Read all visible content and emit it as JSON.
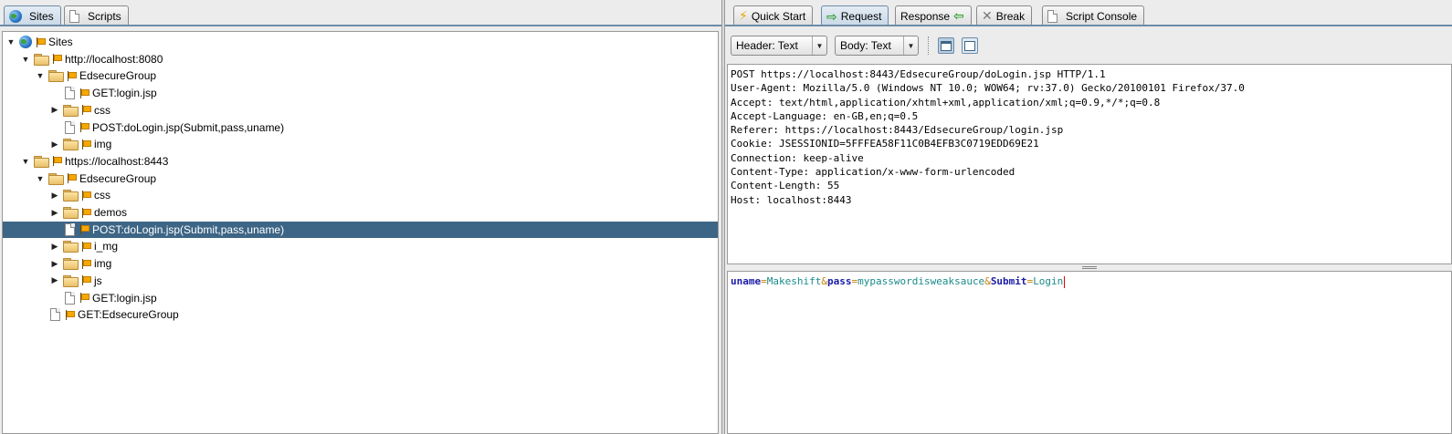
{
  "left_tabs": [
    {
      "label": "Sites",
      "icon": "globe-icon",
      "active": true
    },
    {
      "label": "Scripts",
      "icon": "script-icon",
      "active": false
    }
  ],
  "tree": [
    {
      "label": "Sites",
      "depth": 0,
      "kind": "root",
      "expanded": true
    },
    {
      "label": "http://localhost:8080",
      "depth": 1,
      "kind": "folder",
      "expanded": true
    },
    {
      "label": "EdsecureGroup",
      "depth": 2,
      "kind": "folder",
      "expanded": true
    },
    {
      "label": "GET:login.jsp",
      "depth": 3,
      "kind": "page"
    },
    {
      "label": "css",
      "depth": 3,
      "kind": "folder",
      "expanded": false
    },
    {
      "label": "POST:doLogin.jsp(Submit,pass,uname)",
      "depth": 3,
      "kind": "page"
    },
    {
      "label": "img",
      "depth": 3,
      "kind": "folder",
      "expanded": false
    },
    {
      "label": "https://localhost:8443",
      "depth": 1,
      "kind": "folder",
      "expanded": true
    },
    {
      "label": "EdsecureGroup",
      "depth": 2,
      "kind": "folder",
      "expanded": true
    },
    {
      "label": "css",
      "depth": 3,
      "kind": "folder",
      "expanded": false
    },
    {
      "label": "demos",
      "depth": 3,
      "kind": "folder",
      "expanded": false
    },
    {
      "label": "POST:doLogin.jsp(Submit,pass,uname)",
      "depth": 3,
      "kind": "page",
      "selected": true
    },
    {
      "label": "i_mg",
      "depth": 3,
      "kind": "folder",
      "expanded": false
    },
    {
      "label": "img",
      "depth": 3,
      "kind": "folder",
      "expanded": false
    },
    {
      "label": "js",
      "depth": 3,
      "kind": "folder",
      "expanded": false
    },
    {
      "label": "GET:login.jsp",
      "depth": 3,
      "kind": "page"
    },
    {
      "label": "GET:EdsecureGroup",
      "depth": 2,
      "kind": "page"
    }
  ],
  "right_tabs": [
    {
      "label": "Quick Start",
      "icon": "lightning-icon"
    },
    {
      "label": "Request",
      "icon": "arrow-right-icon",
      "active": true
    },
    {
      "label": "Response",
      "icon": "arrow-left-icon"
    },
    {
      "label": "Break",
      "icon": "break-icon"
    },
    {
      "label": "Script Console",
      "icon": "script-icon"
    }
  ],
  "toolbar": {
    "header_select": "Header: Text",
    "body_select": "Body: Text"
  },
  "request_header": "POST https://localhost:8443/EdsecureGroup/doLogin.jsp HTTP/1.1\nUser-Agent: Mozilla/5.0 (Windows NT 10.0; WOW64; rv:37.0) Gecko/20100101 Firefox/37.0\nAccept: text/html,application/xhtml+xml,application/xml;q=0.9,*/*;q=0.8\nAccept-Language: en-GB,en;q=0.5\nReferer: https://localhost:8443/EdsecureGroup/login.jsp\nCookie: JSESSIONID=5FFFEA58F11C0B4EFB3C0719EDD69E21\nConnection: keep-alive\nContent-Type: application/x-www-form-urlencoded\nContent-Length: 55\nHost: localhost:8443",
  "request_body": {
    "params": [
      {
        "key": "uname",
        "value": "Makeshift"
      },
      {
        "key": "pass",
        "value": "mypasswordisweaksauce"
      },
      {
        "key": "Submit",
        "value": "Login"
      }
    ],
    "eq": "=",
    "amp": "&"
  },
  "colors": {
    "selection": "#3d6585",
    "tab_line": "#6d8ca6",
    "param_key": "#1a1aa6",
    "param_value": "#1a8a8a",
    "separator": "#c47c00"
  }
}
